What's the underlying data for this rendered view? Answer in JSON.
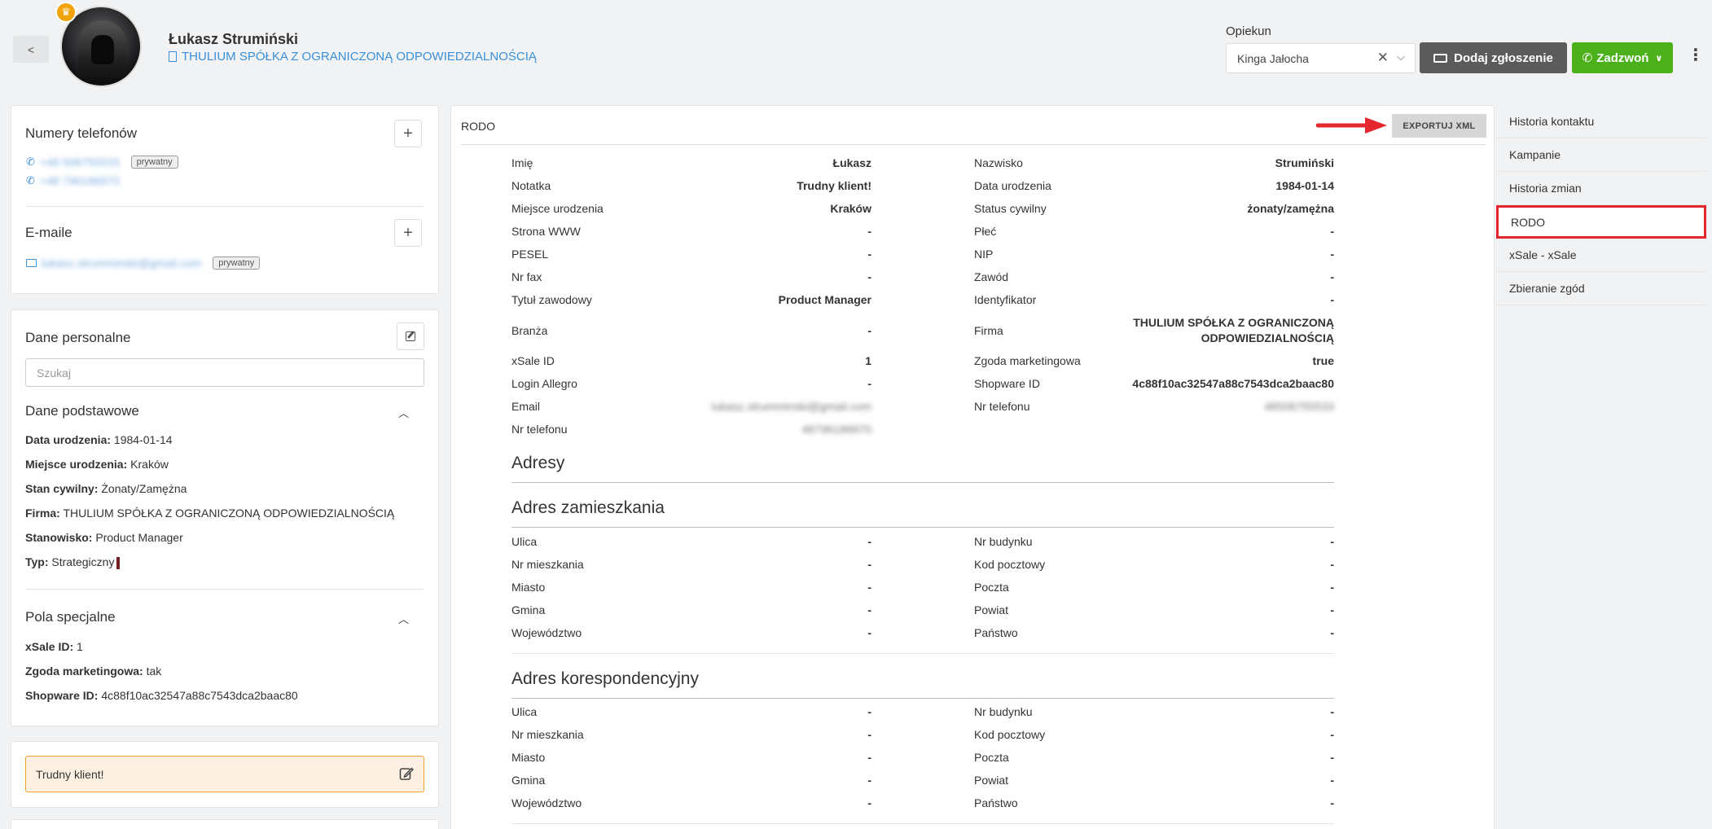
{
  "header": {
    "back_label": "<",
    "person_name": "Łukasz Strumiński",
    "company": "THULIUM SPÓŁKA Z OGRANICZONĄ ODPOWIEDZIALNOŚCIĄ",
    "opiekun_label": "Opiekun",
    "opiekun_value": "Kinga Jałocha",
    "add_ticket_label": "Dodaj zgłoszenie",
    "call_label": "Zadzwoń",
    "colors": {
      "dark_button": "#5b5b5b",
      "green_button": "#4cb01a",
      "link": "#3a8fd8",
      "crown": "#f0a30a"
    }
  },
  "phones": {
    "title": "Numery telefonów",
    "items": [
      {
        "number": "+48 506755533",
        "tag": "prywatny"
      },
      {
        "number": "+48 796186870",
        "tag": ""
      }
    ]
  },
  "emails": {
    "title": "E-maile",
    "items": [
      {
        "address": "lukasz.strumminski@gmail.com",
        "tag": "prywatny"
      }
    ]
  },
  "personal": {
    "title": "Dane personalne",
    "search_placeholder": "Szukaj",
    "basic_title": "Dane podstawowe",
    "basic": [
      {
        "key": "Data urodzenia:",
        "value": "1984-01-14"
      },
      {
        "key": "Miejsce urodzenia:",
        "value": "Kraków"
      },
      {
        "key": "Stan cywilny:",
        "value": "Żonaty/Zamężna"
      },
      {
        "key": "Firma:",
        "value": "THULIUM SPÓŁKA Z OGRANICZONĄ ODPOWIEDZIALNOŚCIĄ"
      },
      {
        "key": "Stanowisko:",
        "value": "Product Manager"
      },
      {
        "key": "Typ:",
        "value": "Strategiczny"
      }
    ],
    "special_title": "Pola specjalne",
    "special": [
      {
        "key": "xSale ID:",
        "value": "1"
      },
      {
        "key": "Zgoda marketingowa:",
        "value": "tak"
      },
      {
        "key": "Shopware ID:",
        "value": "4c88f10ac32547a88c7543dca2baac80"
      }
    ]
  },
  "note": {
    "text": "Trudny klient!"
  },
  "rodo": {
    "title": "RODO",
    "export_label": "EXPORTUJ XML",
    "left_fields": [
      {
        "label": "Imię",
        "value": "Łukasz"
      },
      {
        "label": "Notatka",
        "value": "Trudny klient!"
      },
      {
        "label": "Miejsce urodzenia",
        "value": "Kraków"
      },
      {
        "label": "Strona WWW",
        "value": "-"
      },
      {
        "label": "PESEL",
        "value": "-"
      },
      {
        "label": "Nr fax",
        "value": "-"
      },
      {
        "label": "Tytuł zawodowy",
        "value": "Product Manager"
      },
      {
        "label": "Branża",
        "value": "-"
      },
      {
        "label": "xSale ID",
        "value": "1"
      },
      {
        "label": "Login Allegro",
        "value": "-"
      },
      {
        "label": "Email",
        "value": "lukasz.strumminski@gmail.com"
      },
      {
        "label": "Nr telefonu",
        "value": "48796186870"
      }
    ],
    "right_fields": [
      {
        "label": "Nazwisko",
        "value": "Strumiński"
      },
      {
        "label": "Data urodzenia",
        "value": "1984-01-14"
      },
      {
        "label": "Status cywilny",
        "value": "żonaty/zamężna"
      },
      {
        "label": "Płeć",
        "value": "-"
      },
      {
        "label": "NIP",
        "value": "-"
      },
      {
        "label": "Zawód",
        "value": "-"
      },
      {
        "label": "Identyfikator",
        "value": "-"
      },
      {
        "label": "Firma",
        "value": "THULIUM SPÓŁKA Z OGRANICZONĄ",
        "value2": "ODPOWIEDZIALNOŚCIĄ"
      },
      {
        "label": "Zgoda marketingowa",
        "value": "true"
      },
      {
        "label": "Shopware ID",
        "value": "4c88f10ac32547a88c7543dca2baac80"
      },
      {
        "label": "Nr telefonu",
        "value": "48506755533"
      }
    ],
    "addresses_title": "Adresy",
    "residence_title": "Adres zamieszkania",
    "correspondence_title": "Adres korespondencyjny",
    "address_left": [
      {
        "label": "Ulica",
        "value": "-"
      },
      {
        "label": "Nr mieszkania",
        "value": "-"
      },
      {
        "label": "Miasto",
        "value": "-"
      },
      {
        "label": "Gmina",
        "value": "-"
      },
      {
        "label": "Województwo",
        "value": "-"
      }
    ],
    "address_right": [
      {
        "label": "Nr budynku",
        "value": "-"
      },
      {
        "label": "Kod pocztowy",
        "value": "-"
      },
      {
        "label": "Poczta",
        "value": "-"
      },
      {
        "label": "Powiat",
        "value": "-"
      },
      {
        "label": "Państwo",
        "value": "-"
      }
    ]
  },
  "right_nav": {
    "items": [
      {
        "label": "Historia kontaktu",
        "active": false
      },
      {
        "label": "Kampanie",
        "active": false
      },
      {
        "label": "Historia zmian",
        "active": false
      },
      {
        "label": "RODO",
        "active": true
      },
      {
        "label": "xSale - xSale",
        "active": false
      },
      {
        "label": "Zbieranie zgód",
        "active": false
      }
    ],
    "highlight_color": "#e4272f"
  }
}
